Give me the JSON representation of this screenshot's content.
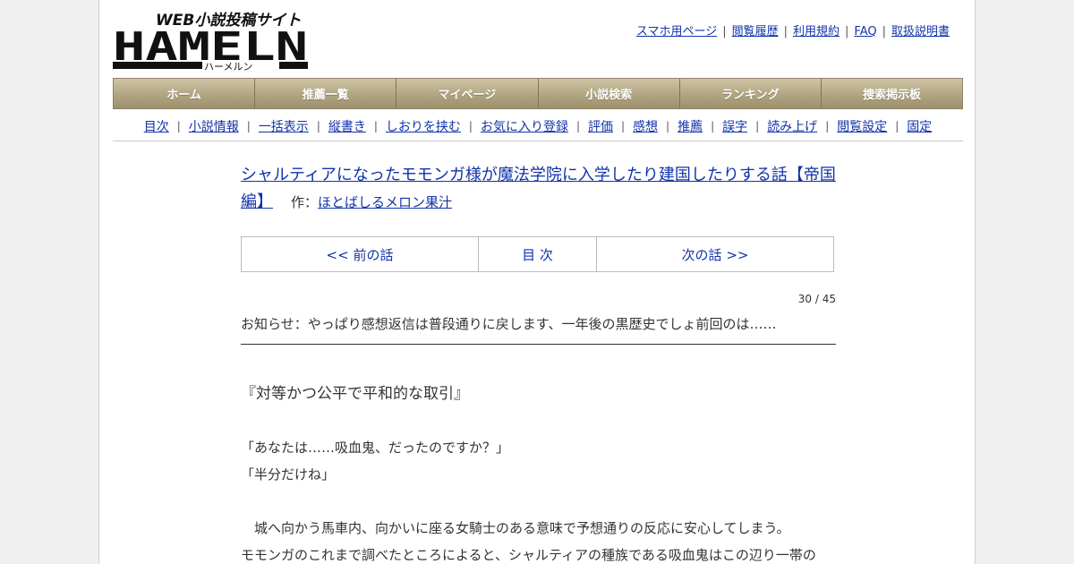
{
  "logo": {
    "tagline": "WEB小説投稿サイト",
    "wordmark": "HAMELN",
    "kana": "ハーメルン"
  },
  "top_links": [
    "スマホ用ページ",
    "閲覧履歴",
    "利用規約",
    "FAQ",
    "取扱説明書"
  ],
  "main_nav": [
    "ホーム",
    "推薦一覧",
    "マイページ",
    "小説検索",
    "ランキング",
    "捜索掲示板"
  ],
  "sub_nav": [
    "目次",
    "小説情報",
    "一括表示",
    "縦書き",
    "しおりを挟む",
    "お気に入り登録",
    "評価",
    "感想",
    "推薦",
    "誤字",
    "読み上げ",
    "閲覧設定",
    "固定"
  ],
  "novel": {
    "title": "シャルティアになったモモンガ様が魔法学院に入学したり建国したりする話【帝国編】",
    "author_prefix": "作：",
    "author": "ほとばしるメロン果汁"
  },
  "chapter_nav": {
    "prev": "<< 前の話",
    "toc": "目 次",
    "next": "次の話 >>"
  },
  "page_count": "30 / 45",
  "notice": "お知らせ：やっぱり感想返信は普段通りに戻します、一年後の黒歴史でしょ前回のは……",
  "body": {
    "heading": "『対等かつ公平で平和的な取引』",
    "line1": "「あなたは……吸血鬼、だったのですか？」",
    "line2": "「半分だけね」",
    "line3": "　城へ向かう馬車内、向かいに座る女騎士のある意味で予想通りの反応に安心してしまう。",
    "line4": "モモンガのこれまで調べたところによると、シャルティアの種族である吸血鬼はこの辺り一帯の"
  },
  "colors": {
    "link": "#1133aa",
    "nav_gold": "#b3a784",
    "background": "#f0f0f0"
  }
}
